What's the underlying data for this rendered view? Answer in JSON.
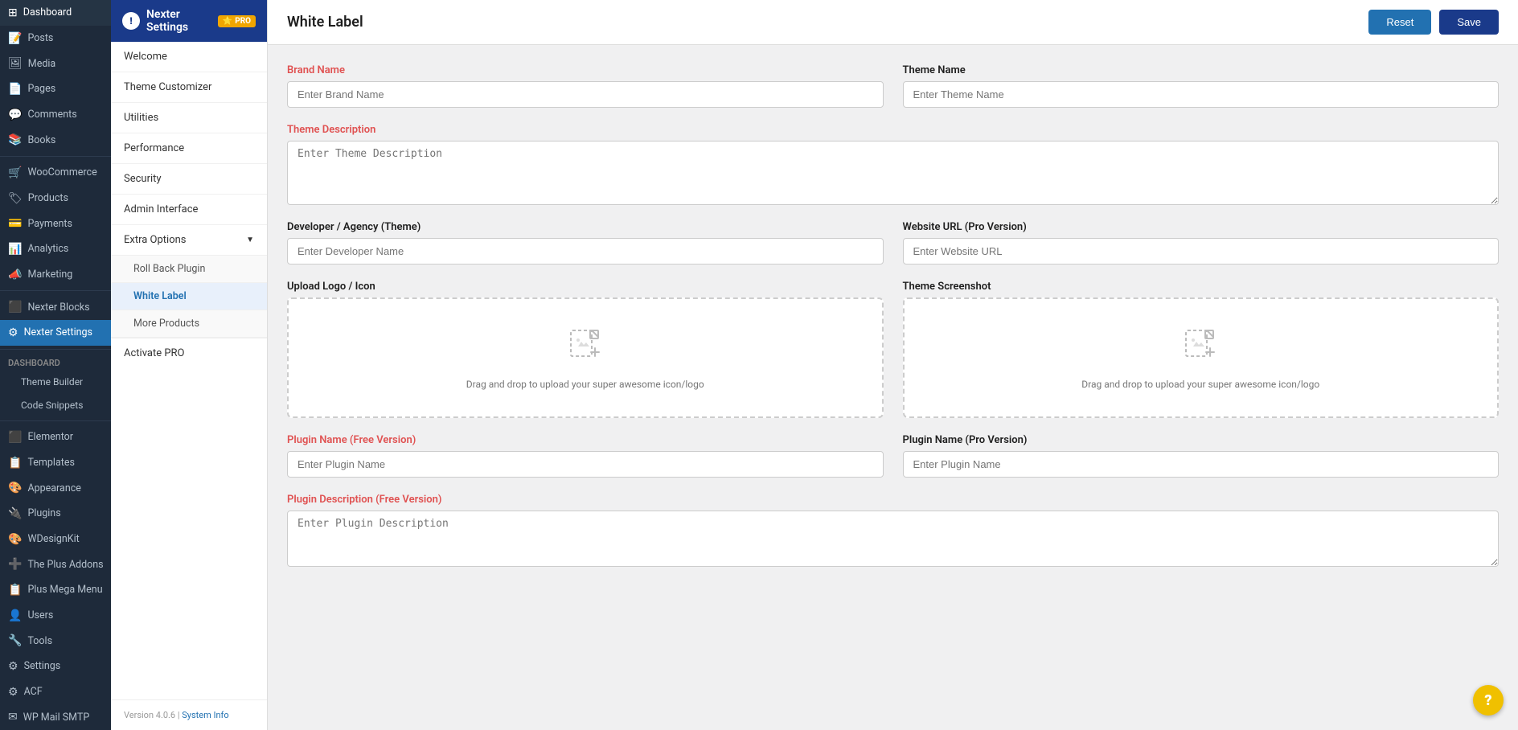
{
  "sidebar": {
    "items": [
      {
        "id": "dashboard",
        "label": "Dashboard",
        "icon": "⊞",
        "active": false
      },
      {
        "id": "posts",
        "label": "Posts",
        "icon": "📝",
        "active": false
      },
      {
        "id": "media",
        "label": "Media",
        "icon": "🖼",
        "active": false
      },
      {
        "id": "pages",
        "label": "Pages",
        "icon": "📄",
        "active": false
      },
      {
        "id": "comments",
        "label": "Comments",
        "icon": "💬",
        "active": false
      },
      {
        "id": "books",
        "label": "Books",
        "icon": "📚",
        "active": false
      },
      {
        "id": "woocommerce",
        "label": "WooCommerce",
        "icon": "🛒",
        "active": false
      },
      {
        "id": "products",
        "label": "Products",
        "icon": "🏷",
        "active": false
      },
      {
        "id": "payments",
        "label": "Payments",
        "icon": "💳",
        "active": false
      },
      {
        "id": "analytics",
        "label": "Analytics",
        "icon": "📊",
        "active": false
      },
      {
        "id": "marketing",
        "label": "Marketing",
        "icon": "📣",
        "active": false
      },
      {
        "id": "nexter-blocks",
        "label": "Nexter Blocks",
        "icon": "⬛",
        "active": false
      },
      {
        "id": "nexter-settings",
        "label": "Nexter Settings",
        "icon": "⚙",
        "active": true
      }
    ],
    "dashboard_section": {
      "label": "Dashboard",
      "sub_items": [
        {
          "id": "theme-builder",
          "label": "Theme Builder"
        },
        {
          "id": "code-snippets",
          "label": "Code Snippets"
        }
      ]
    },
    "elementor_section": {
      "items": [
        {
          "id": "elementor",
          "label": "Elementor",
          "icon": "⬛"
        },
        {
          "id": "templates",
          "label": "Templates",
          "icon": "📋"
        },
        {
          "id": "appearance",
          "label": "Appearance",
          "icon": "🎨"
        },
        {
          "id": "plugins",
          "label": "Plugins",
          "icon": "🔌"
        },
        {
          "id": "wdesignkit",
          "label": "WDesignKit",
          "icon": "🎨"
        },
        {
          "id": "the-plus-addons",
          "label": "The Plus Addons",
          "icon": "➕"
        },
        {
          "id": "plus-mega-menu",
          "label": "Plus Mega Menu",
          "icon": "📋"
        },
        {
          "id": "users",
          "label": "Users",
          "icon": "👤"
        },
        {
          "id": "tools",
          "label": "Tools",
          "icon": "🔧"
        },
        {
          "id": "settings",
          "label": "Settings",
          "icon": "⚙"
        },
        {
          "id": "acf",
          "label": "ACF",
          "icon": "⚙"
        },
        {
          "id": "wp-mail-smtp",
          "label": "WP Mail SMTP",
          "icon": "✉"
        }
      ]
    }
  },
  "left_panel": {
    "header": {
      "title": "Nexter Settings",
      "icon_text": "!",
      "pro_label": "PRO",
      "pro_icon": "⭐"
    },
    "menu_items": [
      {
        "id": "welcome",
        "label": "Welcome",
        "active": false
      },
      {
        "id": "theme-customizer",
        "label": "Theme Customizer",
        "active": false
      },
      {
        "id": "utilities",
        "label": "Utilities",
        "active": false
      },
      {
        "id": "performance",
        "label": "Performance",
        "active": false
      },
      {
        "id": "security",
        "label": "Security",
        "active": false
      },
      {
        "id": "admin-interface",
        "label": "Admin Interface",
        "active": false
      }
    ],
    "extra_options": {
      "label": "Extra Options",
      "sub_items": [
        {
          "id": "roll-back-plugin",
          "label": "Roll Back Plugin",
          "active": false
        },
        {
          "id": "white-label",
          "label": "White Label",
          "active": true
        },
        {
          "id": "more-products",
          "label": "More Products",
          "active": false
        }
      ]
    },
    "activate_pro": {
      "label": "Activate PRO"
    },
    "footer": {
      "version": "Version 4.0.6",
      "separator": "|",
      "system_info": "System Info"
    }
  },
  "right_panel": {
    "title": "White Label",
    "buttons": {
      "reset": "Reset",
      "save": "Save"
    },
    "form": {
      "brand_name": {
        "label": "Brand Name",
        "placeholder": "Enter Brand Name",
        "required": true
      },
      "theme_name": {
        "label": "Theme Name",
        "placeholder": "Enter Theme Name",
        "required": false
      },
      "theme_description": {
        "label": "Theme Description",
        "placeholder": "Enter Theme Description",
        "required": true
      },
      "developer_agency": {
        "label": "Developer / Agency (Theme)",
        "placeholder": "Enter Developer Name",
        "required": false
      },
      "website_url": {
        "label": "Website URL (Pro Version)",
        "placeholder": "Enter Website URL",
        "required": false
      },
      "upload_logo": {
        "label": "Upload Logo / Icon",
        "drag_text": "Drag and drop to upload your super awesome icon/logo"
      },
      "theme_screenshot": {
        "label": "Theme Screenshot",
        "drag_text": "Drag and drop to upload your super awesome icon/logo"
      },
      "plugin_name_free": {
        "label": "Plugin Name (Free Version)",
        "placeholder": "Enter Plugin Name",
        "required": true
      },
      "plugin_name_pro": {
        "label": "Plugin Name (Pro Version)",
        "placeholder": "Enter Plugin Name",
        "required": false
      },
      "plugin_description_free": {
        "label": "Plugin Description (Free Version)",
        "placeholder": "Enter Plugin Description",
        "required": true
      }
    }
  },
  "help_button": {
    "label": "?",
    "color": "#f0c000"
  }
}
